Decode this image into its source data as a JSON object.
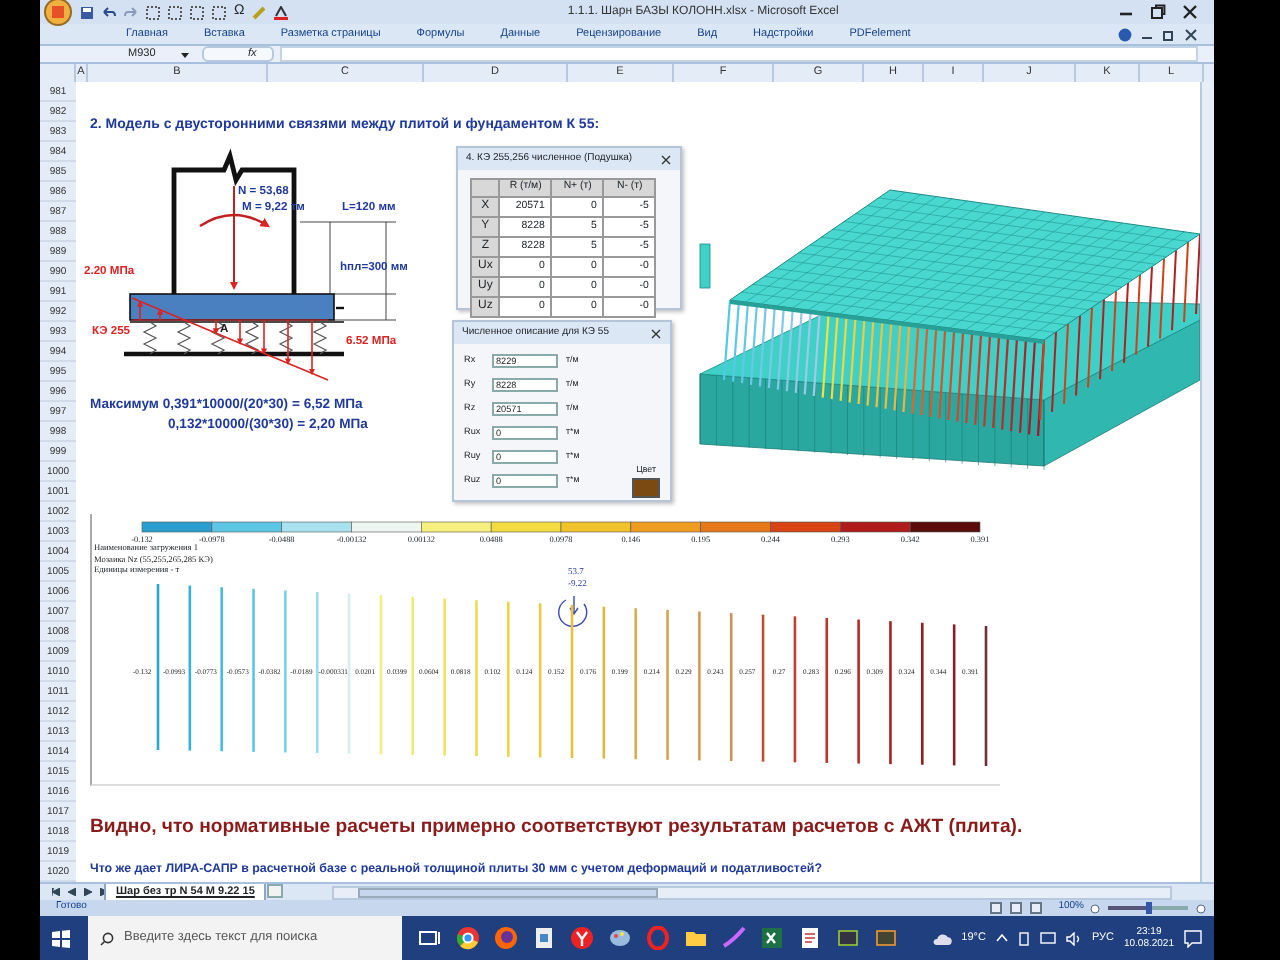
{
  "window": {
    "title": "1.1.1. Шарн БАЗЫ КОЛОНН.xlsx - Microsoft Excel"
  },
  "quick_access": {
    "symbol": "Ω"
  },
  "ribbon_tabs": [
    {
      "label": "Главная",
      "selected": false
    },
    {
      "label": "Вставка",
      "selected": false
    },
    {
      "label": "Разметка страницы",
      "selected": false
    },
    {
      "label": "Формулы",
      "selected": false
    },
    {
      "label": "Данные",
      "selected": false
    },
    {
      "label": "Рецензирование",
      "selected": false
    },
    {
      "label": "Вид",
      "selected": false
    },
    {
      "label": "Надстройки",
      "selected": false
    },
    {
      "label": "PDFelement",
      "selected": false
    }
  ],
  "formula_bar": {
    "name_box": "M930",
    "function_label": "fx"
  },
  "columns": [
    "A",
    "B",
    "C",
    "D",
    "E",
    "F",
    "G",
    "H",
    "I",
    "J",
    "K",
    "L"
  ],
  "rows": [
    "981",
    "982",
    "983",
    "984",
    "985",
    "986",
    "987",
    "988",
    "989",
    "990",
    "991",
    "992",
    "993",
    "994",
    "995",
    "996",
    "997",
    "998",
    "999",
    "1000",
    "1001",
    "1002",
    "1003",
    "1004",
    "1005",
    "1006",
    "1007",
    "1008",
    "1009",
    "1010",
    "1011",
    "1012",
    "1013",
    "1014",
    "1015",
    "1016",
    "1017",
    "1018",
    "1019",
    "1020"
  ],
  "heading": "2. Модель с двусторонними связями между плитой и фундаментом К 55:",
  "sketch": {
    "labels": [
      {
        "kind": "force",
        "text": "N = 53,68"
      },
      {
        "kind": "force",
        "text": "M = 9,22 тм"
      },
      {
        "kind": "dimension",
        "text": "L=120 мм"
      },
      {
        "kind": "dimension",
        "text": "hпл=300 мм"
      },
      {
        "kind": "stress",
        "text": "2.20 МПа"
      },
      {
        "kind": "stress",
        "text": "КЭ 255"
      },
      {
        "kind": "point",
        "text": "A"
      },
      {
        "kind": "stress",
        "text": "6.52 МПа"
      }
    ]
  },
  "formulas": [
    "Максимум 0,391*10000/(20*30) = 6,52 МПа",
    "0,132*10000/(30*30) = 2,20 МПа"
  ],
  "stiffness_dialog": {
    "title": "4. КЭ 255,256 численное (Подушка)",
    "columns": [
      "",
      "R (т/м)",
      "N+ (т)",
      "N- (т)"
    ],
    "rows": [
      [
        "X",
        "20571",
        "0",
        "-5"
      ],
      [
        "Y",
        "8228",
        "5",
        "-5"
      ],
      [
        "Z",
        "8228",
        "5",
        "-5"
      ],
      [
        "Ux",
        "0",
        "0",
        "-0"
      ],
      [
        "Uy",
        "0",
        "0",
        "-0"
      ],
      [
        "Uz",
        "0",
        "0",
        "-0"
      ]
    ]
  },
  "description_dialog": {
    "title": "Численное описание для КЭ 55",
    "color_label": "Цвет",
    "color": "#7a4a12",
    "fields": [
      {
        "label": "Rx",
        "value": "8229",
        "unit": "т/м"
      },
      {
        "label": "Ry",
        "value": "8228",
        "unit": "т/м"
      },
      {
        "label": "Rz",
        "value": "20571",
        "unit": "т/м"
      },
      {
        "label": "Rux",
        "value": "0",
        "unit": "т*м"
      },
      {
        "label": "Ruy",
        "value": "0",
        "unit": "т*м"
      },
      {
        "label": "Ruz",
        "value": "0",
        "unit": "т*м"
      }
    ]
  },
  "mosaic": {
    "legend": {
      "ticks": [
        "-0.132",
        "-0.0978",
        "-0.0488",
        "-0.00132",
        "0.00132",
        "0.0488",
        "0.0978",
        "0.146",
        "0.195",
        "0.244",
        "0.293",
        "0.342",
        "0.391"
      ],
      "segments": [
        {
          "color": "#2a9fd0"
        },
        {
          "color": "#5cc6e4"
        },
        {
          "color": "#a8e2ee"
        },
        {
          "color": "#eef6f2"
        },
        {
          "color": "#f6f07e"
        },
        {
          "color": "#f2dc40"
        },
        {
          "color": "#f0c22c"
        },
        {
          "color": "#ee9c22"
        },
        {
          "color": "#e6781a"
        },
        {
          "color": "#d84414"
        },
        {
          "color": "#b01c1c"
        },
        {
          "color": "#5a0c0c"
        }
      ]
    },
    "info": [
      "Наименование загружения 1",
      "Мозаика Nz (55,255,265,285 КЭ)",
      "Единицы измерения - т"
    ],
    "marker": {
      "force": "53.7",
      "moment": "-9.22"
    },
    "bars": [
      {
        "label": "-0.132",
        "color": "#2aa6d2"
      },
      {
        "label": "-0.0993",
        "color": "#36b2da"
      },
      {
        "label": "-0.0773",
        "color": "#46bce0"
      },
      {
        "label": "-0.0573",
        "color": "#5cc6e4"
      },
      {
        "label": "-0.0382",
        "color": "#78d0ea"
      },
      {
        "label": "-0.0189",
        "color": "#96dcee"
      },
      {
        "label": "-0.000331",
        "color": "#d6eeee"
      },
      {
        "label": "0.0201",
        "color": "#f2ee80"
      },
      {
        "label": "0.0399",
        "color": "#f0e870"
      },
      {
        "label": "0.0604",
        "color": "#eee260"
      },
      {
        "label": "0.0818",
        "color": "#ecdc50"
      },
      {
        "label": "0.102",
        "color": "#eed448"
      },
      {
        "label": "0.124",
        "color": "#ecca40"
      },
      {
        "label": "0.152",
        "color": "#e8c040"
      },
      {
        "label": "0.176",
        "color": "#e0b648"
      },
      {
        "label": "0.199",
        "color": "#d8ac50"
      },
      {
        "label": "0.214",
        "color": "#d4a452"
      },
      {
        "label": "0.229",
        "color": "#d09c54"
      },
      {
        "label": "0.243",
        "color": "#cc9456"
      },
      {
        "label": "0.257",
        "color": "#c44a34"
      },
      {
        "label": "0.27",
        "color": "#c04030"
      },
      {
        "label": "0.283",
        "color": "#bc3828"
      },
      {
        "label": "0.296",
        "color": "#b42c24"
      },
      {
        "label": "0.309",
        "color": "#a82222"
      },
      {
        "label": "0.324",
        "color": "#981c20"
      },
      {
        "label": "0.344",
        "color": "#84202a"
      },
      {
        "label": "0.391",
        "color": "#703038"
      }
    ]
  },
  "conclusion": "Видно, что нормативные расчеты примерно соответствуют результатам расчетов с АЖТ (плита).",
  "question": "Что же дает ЛИРА-САПР в расчетной базе с реальной толщиной плиты 30 мм с учетом деформаций и податливостей?",
  "sheet_tabs": [
    {
      "label": "Шар без тр N 54 M 9.22 15",
      "selected": true
    }
  ],
  "status_bar": {
    "text": "Готово",
    "zoom": {
      "label": "100%",
      "level": 0.5
    }
  },
  "taskbar": {
    "search_placeholder": "Введите здесь текст для поиска",
    "weather": "19°C",
    "language": "РУС",
    "time": "23:19",
    "date": "10.08.2021"
  }
}
